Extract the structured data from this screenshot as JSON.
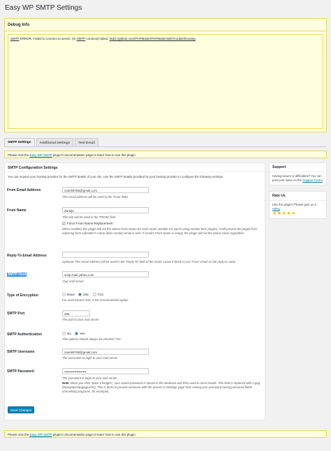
{
  "page_title": "Easy WP SMTP Settings",
  "debug": {
    "title": "Debug Info",
    "message_pre": "SMTP",
    "message_1": " ERROR: Failed to connect to server:  (0) ",
    "message_smtp2": "SMTP",
    "message_2": " connect() failed. ",
    "message_link": "https://github.com/PHPMailer/PHPMailer/wiki/Troubleshooting"
  },
  "tabs": [
    {
      "label": "SMTP Settings",
      "active": true
    },
    {
      "label": "Additional Settings",
      "active": false
    },
    {
      "label": "Test Email",
      "active": false
    }
  ],
  "notice": {
    "pre": "Please visit the ",
    "link": "Easy WP SMTP",
    "post": " plugin's documentation page to learn how to use this plugin."
  },
  "panel": {
    "title": "SMTP Configuration Settings",
    "intro": "You can request your hosting provider for the SMTP details of your site. Use the SMTP details provided by your hosting provider to configure the following settings."
  },
  "fields": {
    "from_email": {
      "label": "From Email Address",
      "value": "zaneti9788@gmail.com",
      "desc": "This email address will be used in the 'From' field."
    },
    "from_name": {
      "label": "From Name",
      "value": "Zarulja",
      "desc": "This text will be used in the 'FROM' field",
      "checkbox_label": "Force From Name Replacement",
      "checkbox_desc": "When enabled, the plugin will set the above From Name for each email. Disable it if you're using contact form plugins, it will prevent the plugin from replacing form submitter's name when contact email is sent. If email's From Name is empty, the plugin will set the above value regardless."
    },
    "reply_to": {
      "label": "Reply-To Email Address",
      "value": "",
      "desc": "Optional. This email address will be used in the 'Reply-To' field of the email. Leave it blank to use 'From' email as the reply-to value."
    },
    "smtp_host": {
      "label": "SMTP Host",
      "value": "smtp.mail.yahoo.com",
      "desc": "Your mail server"
    },
    "encryption": {
      "label": "Type of Encryption",
      "options": [
        "None",
        "SSL",
        "TLS"
      ],
      "selected": "SSL",
      "desc": "For most servers SSL is the recommended option"
    },
    "smtp_port": {
      "label": "SMTP Port",
      "value": "465",
      "desc": "The port to your mail server"
    },
    "smtp_auth": {
      "label": "SMTP Authentication",
      "options": [
        "No",
        "Yes"
      ],
      "selected": "Yes",
      "desc": "This options should always be checked 'Yes'"
    },
    "smtp_username": {
      "label": "SMTP Username",
      "value": "zaneti9788@gmail.com",
      "desc": "The username to login to your mail server"
    },
    "smtp_password": {
      "label": "SMTP Password",
      "value": "••••••••••••••••••••",
      "desc": "The password to login to your mail server",
      "note_bold": "Note",
      "note": ": when you click \"Save Changes\", your actual password is stored in the database and then used to send emails. This field is replaced with a gag (#easywpsmtpgagpass#). This is done to prevent someone with the access to Settings page from seeing your password (using password fields unmasking programs, for example)."
    }
  },
  "save_label": "Save Changes",
  "sidebar": {
    "support": {
      "title": "Support",
      "text_pre": "Having issues or difficulties? You can post your issue on the ",
      "link": "Support Forum"
    },
    "rate": {
      "title": "Rate Us",
      "text_pre": "Like the plugin? Please give us a ",
      "link": "rating",
      "stars": "★★★★★"
    }
  },
  "colors": {
    "accent": "#0085ba",
    "notice_bg": "#ffffe0",
    "notice_border": "#e6db55",
    "link": "#0073aa",
    "star": "#ffb900"
  }
}
